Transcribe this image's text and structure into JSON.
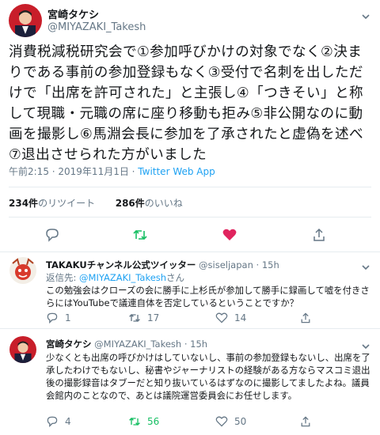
{
  "main_tweet": {
    "author_name": "宮崎タケシ",
    "author_handle": "@MIYAZAKI_Takesh",
    "text": "消費税減税研究会で①参加呼びかけの対象でなく②決まりである事前の参加登録もなく③受付で名刺を出しただけで「出席を許可された」と主張し④「つきそい」と称して現職・元職の席に座り移動も拒み⑤非公開なのに動画を撮影し⑥馬淵会長に参加を了承されたと虚偽を述べ⑦退出させられた方がいました",
    "timestamp": "午前2:15 · 2019年11月1日 · ",
    "source": "Twitter Web App",
    "retweets_count": "234件",
    "retweets_label": "のリツイート",
    "likes_count": "286件",
    "likes_label": "のいいね"
  },
  "replies": [
    {
      "author_name": "TAKAKUチャンネル公式ツイッター",
      "author_handle": "@siseljapan",
      "time": "15h",
      "replying_prefix": "返信先:",
      "replying_to": "@MIYAZAKI_Takesh",
      "replying_suffix": "さん",
      "text": "この勉強会はクローズの会に勝手に上杉氏が参加して勝手に録画して嘘を付きさらにはYouTubeで議連自体を否定しているということですか？",
      "reply_count": "1",
      "retweet_count": "17",
      "like_count": "14"
    },
    {
      "author_name": "宮崎タケシ",
      "author_handle": "@MIYAZAKI_Takesh",
      "time": "15h",
      "text": "少なくとも出席の呼びかけはしていないし、事前の参加登録もないし、出席を了承したわけでもないし、秘書やジャーナリストの経験がある方ならマスコミ退出後の撮影録音はタブーだと知り抜いているはずなのに撮影してましたよね。議員会館内のことなので、あとは議院運営委員会にお任せします。",
      "reply_count": "4",
      "retweet_count": "56",
      "like_count": "50"
    }
  ],
  "colors": {
    "accent": "#1da1f2",
    "retweet_green": "#17bf63",
    "like_red": "#e0245e",
    "muted": "#657786"
  }
}
